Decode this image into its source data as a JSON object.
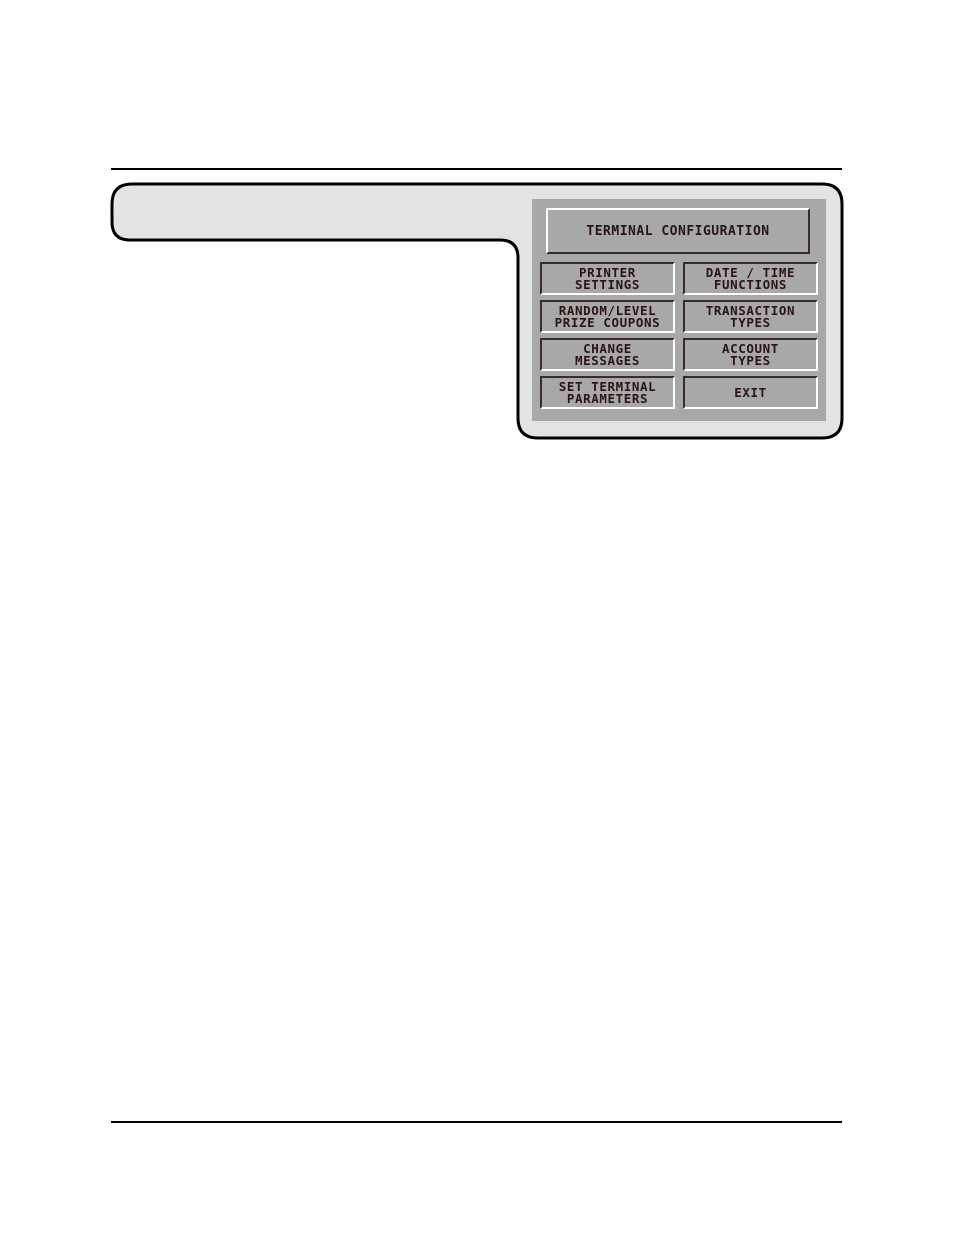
{
  "screen": {
    "title": "TERMINAL CONFIGURATION",
    "colors": {
      "frame_fill": "#e3e3e3",
      "panel_fill": "#a8a8a8",
      "text": "#2a1416",
      "outline": "#000000"
    }
  },
  "buttons": [
    {
      "id": "printer-settings",
      "line1": "PRINTER",
      "line2": "SETTINGS"
    },
    {
      "id": "date-time-functions",
      "line1": "DATE / TIME",
      "line2": "FUNCTIONS"
    },
    {
      "id": "random-level-prize-coupons",
      "line1": "RANDOM/LEVEL",
      "line2": "PRIZE COUPONS"
    },
    {
      "id": "transaction-types",
      "line1": "TRANSACTION",
      "line2": "TYPES"
    },
    {
      "id": "change-messages",
      "line1": "CHANGE",
      "line2": "MESSAGES"
    },
    {
      "id": "account-types",
      "line1": "ACCOUNT",
      "line2": "TYPES"
    },
    {
      "id": "set-terminal-parameters",
      "line1": "SET TERMINAL",
      "line2": "PARAMETERS"
    },
    {
      "id": "exit",
      "line1": "EXIT",
      "line2": ""
    }
  ]
}
